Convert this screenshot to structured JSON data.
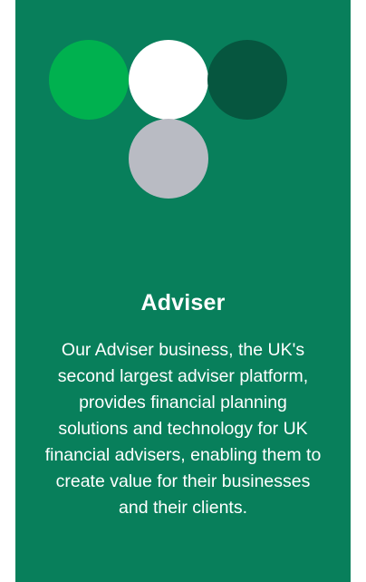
{
  "card": {
    "background": "#087f5b",
    "logo": {
      "circles": [
        {
          "name": "green",
          "color": "#00b14f"
        },
        {
          "name": "white",
          "color": "#ffffff"
        },
        {
          "name": "dark-green",
          "color": "#06563f"
        },
        {
          "name": "grey",
          "color": "#b9bbc3"
        }
      ]
    },
    "title": "Adviser",
    "description": "Our Adviser business, the UK's second largest adviser platform, provides financial planning solutions and technology for UK financial advisers, enabling them to create value for their businesses and their clients."
  }
}
